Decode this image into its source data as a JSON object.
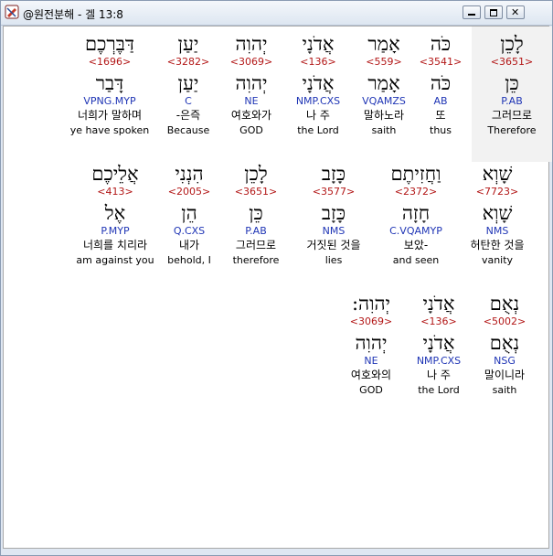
{
  "window": {
    "title": "@원전분해 - 겔 13:8",
    "buttons": {
      "minimize_icon": "minimize-icon",
      "maximize_icon": "maximize-icon",
      "close_icon": "close-icon"
    }
  },
  "rows": [
    [
      {
        "hebrew": "לָכֵן",
        "strong": "<3651>",
        "root": "כֵּן",
        "morph": "P.AB",
        "korean": "그러므로",
        "english": "Therefore",
        "selected": true
      },
      {
        "hebrew": "כֹּה",
        "strong": "<3541>",
        "root": "כֹּה",
        "morph": "AB",
        "korean": "또",
        "english": "thus"
      },
      {
        "hebrew": "אָמַר",
        "strong": "<559>",
        "root": "אָמַר",
        "morph": "VQAMZS",
        "korean": "말하노라",
        "english": "saith"
      },
      {
        "hebrew": "אֲדֹנָי",
        "strong": "<136>",
        "root": "אֲדֹנָי",
        "morph": "NMP.CXS",
        "korean": "나 주",
        "english": "the Lord"
      },
      {
        "hebrew": "יְהוִה",
        "strong": "<3069>",
        "root": "יְהוִה",
        "morph": "NE",
        "korean": "여호와가",
        "english": "GOD"
      },
      {
        "hebrew": "יַעַן",
        "strong": "<3282>",
        "root": "יַעַן",
        "morph": "C",
        "korean": "-은즉",
        "english": "Because"
      },
      {
        "hebrew": "דַּבֶּרְכֶם",
        "strong": "<1696>",
        "root": "דָּבַר",
        "morph": "VPNG.MYP",
        "korean": "너희가 말하며",
        "english": "ye have spoken"
      }
    ],
    [
      {
        "hebrew": "שָׁוְא",
        "strong": "<7723>",
        "root": "שָׁוְא",
        "morph": "NMS",
        "korean": "허탄한 것을",
        "english": "vanity"
      },
      {
        "hebrew": "וַחֲזִיתֶם",
        "strong": "<2372>",
        "root": "חָזָה",
        "morph": "C.VQAMYP",
        "korean": "보았-",
        "english": "and seen"
      },
      {
        "hebrew": "כָּזָב",
        "strong": "<3577>",
        "root": "כָּזָב",
        "morph": "NMS",
        "korean": "거짓된 것을",
        "english": "lies"
      },
      {
        "hebrew": "לָכֵן",
        "strong": "<3651>",
        "root": "כֵּן",
        "morph": "P.AB",
        "korean": "그러므로",
        "english": "therefore"
      },
      {
        "hebrew": "הִנְנִי",
        "strong": "<2005>",
        "root": "הֵן",
        "morph": "Q.CXS",
        "korean": "내가",
        "english": "behold, I"
      },
      {
        "hebrew": "אֲלֵיכֶם",
        "strong": "<413>",
        "root": "אֶל",
        "morph": "P.MYP",
        "korean": "너희를 치리라",
        "english": "am against you"
      }
    ],
    [
      {
        "hebrew": "נְאֻם",
        "strong": "<5002>",
        "root": "נְאֻם",
        "morph": "NSG",
        "korean": "말이니라",
        "english": "saith"
      },
      {
        "hebrew": "אֲדֹנָי",
        "strong": "<136>",
        "root": "אֲדֹנָי",
        "morph": "NMP.CXS",
        "korean": "나 주",
        "english": "the Lord"
      },
      {
        "hebrew": "יְהוִה:",
        "strong": "<3069>",
        "root": "יְהוִה",
        "morph": "NE",
        "korean": "여호와의",
        "english": "GOD"
      }
    ]
  ]
}
